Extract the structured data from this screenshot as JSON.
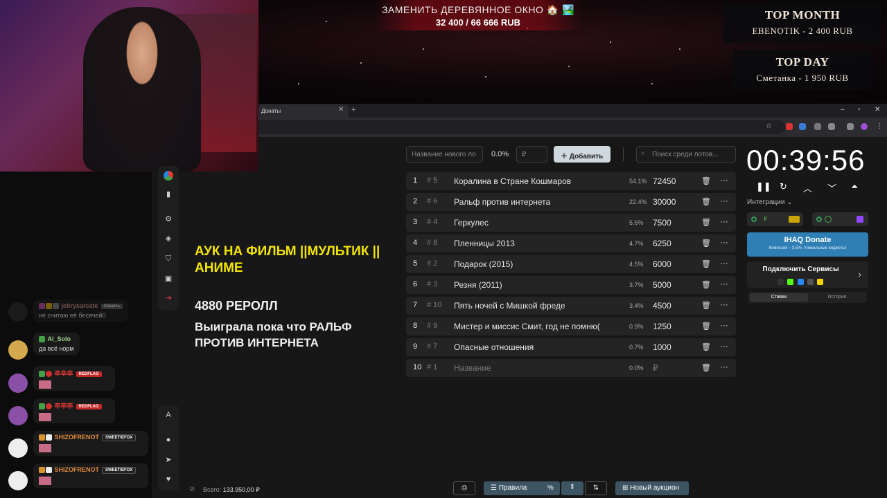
{
  "goal": {
    "title": "ЗАМЕНИТЬ ДЕРЕВЯННОЕ ОКНО 🏠 🏞️",
    "progress": "32 400 / 66 666 RUB"
  },
  "top_month": {
    "title": "TOP MONTH",
    "line": "EBENOTIK  -  2 400 RUB"
  },
  "top_day": {
    "title": "TOP DAY",
    "line": "Сметанка  -  1 950 RUB"
  },
  "browser": {
    "tab_label": "Донаты",
    "tab_close": "✕",
    "new_tab": "+"
  },
  "toolbar": {
    "new_lot_placeholder": "Название нового ло",
    "pct": "0.0%",
    "amount_placeholder": "₽",
    "add_label": "Добавить",
    "search_placeholder": "Поиск среди лотов..."
  },
  "overlay": {
    "theme": "АУК НА ФИЛЬМ ||МУЛЬТИК || АНИМЕ",
    "reroll": "4880 РЕРОЛЛ",
    "note": "Выиграла пока что РАЛЬФ ПРОТИВ ИНТЕРНЕТА"
  },
  "lots": [
    {
      "num": "1",
      "id": "# 5",
      "name": "Коралина в Стране Кошмаров",
      "pct": "54.1%",
      "amount": "72450"
    },
    {
      "num": "2",
      "id": "# 6",
      "name": "Ральф против интернета",
      "pct": "22.4%",
      "amount": "30000"
    },
    {
      "num": "3",
      "id": "# 4",
      "name": "Геркулес",
      "pct": "5.6%",
      "amount": "7500"
    },
    {
      "num": "4",
      "id": "# 8",
      "name": "Пленницы 2013",
      "pct": "4.7%",
      "amount": "6250"
    },
    {
      "num": "5",
      "id": "# 2",
      "name": "Подарок (2015)",
      "pct": "4.5%",
      "amount": "6000"
    },
    {
      "num": "6",
      "id": "# 3",
      "name": "Резня (2011)",
      "pct": "3.7%",
      "amount": "5000"
    },
    {
      "num": "7",
      "id": "# 10",
      "name": "Пять ночей с Мишкой фреде",
      "pct": "3.4%",
      "amount": "4500"
    },
    {
      "num": "8",
      "id": "# 9",
      "name": "Мистер и миссис Смит, год не помню(",
      "pct": "0.9%",
      "amount": "1250"
    },
    {
      "num": "9",
      "id": "# 7",
      "name": "Опасные отношения",
      "pct": "0.7%",
      "amount": "1000"
    },
    {
      "num": "10",
      "id": "# 1",
      "name": "Название",
      "pct": "0.0%",
      "amount": "₽"
    }
  ],
  "timer": {
    "value": "00:39:56"
  },
  "integrations": {
    "label": "Интеграции ⌄"
  },
  "ihaq": {
    "title": "IHAQ Donate",
    "subtitle": "Комиссия – 3,5%. Уникальные виджеты!"
  },
  "services": {
    "title": "Подключить Сервисы"
  },
  "bid_tabs": {
    "bets": "Ставки",
    "history": "История"
  },
  "bottom": {
    "total_label": "Всего:",
    "total_value": "133.950,00 ₽",
    "rules": "Правила",
    "percent": "%",
    "new_auction": "Новый аукцион"
  },
  "chat": [
    {
      "name": "jebrysarcate",
      "tag": "Сказать",
      "text": "не считаю её бесячей0"
    },
    {
      "name": "Al_Solo",
      "text": "да всё норм"
    },
    {
      "name": "卒卒卒",
      "tag": "REDFLAG",
      "text": ""
    },
    {
      "name": "卒卒卒",
      "tag": "REDFLAG",
      "text": ""
    },
    {
      "name": "SHIZOFRENOT",
      "tag": "SWEETIEFOX",
      "text": ""
    },
    {
      "name": "SHIZOFRENOT",
      "tag": "SWEETIEFOX",
      "text": ""
    }
  ],
  "colors": {
    "accent_yellow": "#f2e400",
    "ihaq_blue": "#2f7fb5",
    "redflag": "#c62828"
  }
}
